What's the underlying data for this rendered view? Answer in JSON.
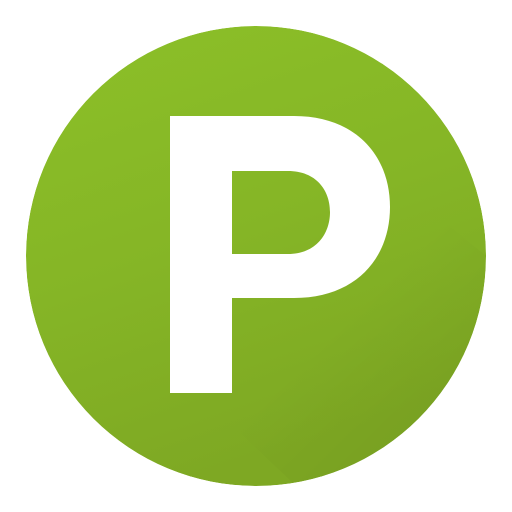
{
  "icon": {
    "name": "parking-icon",
    "letter": "P",
    "colors": {
      "background": "#ffffff",
      "circle_light": "#8cc028",
      "circle_mid": "#85b526",
      "circle_dark": "#7ea823",
      "letter": "#ffffff"
    }
  }
}
